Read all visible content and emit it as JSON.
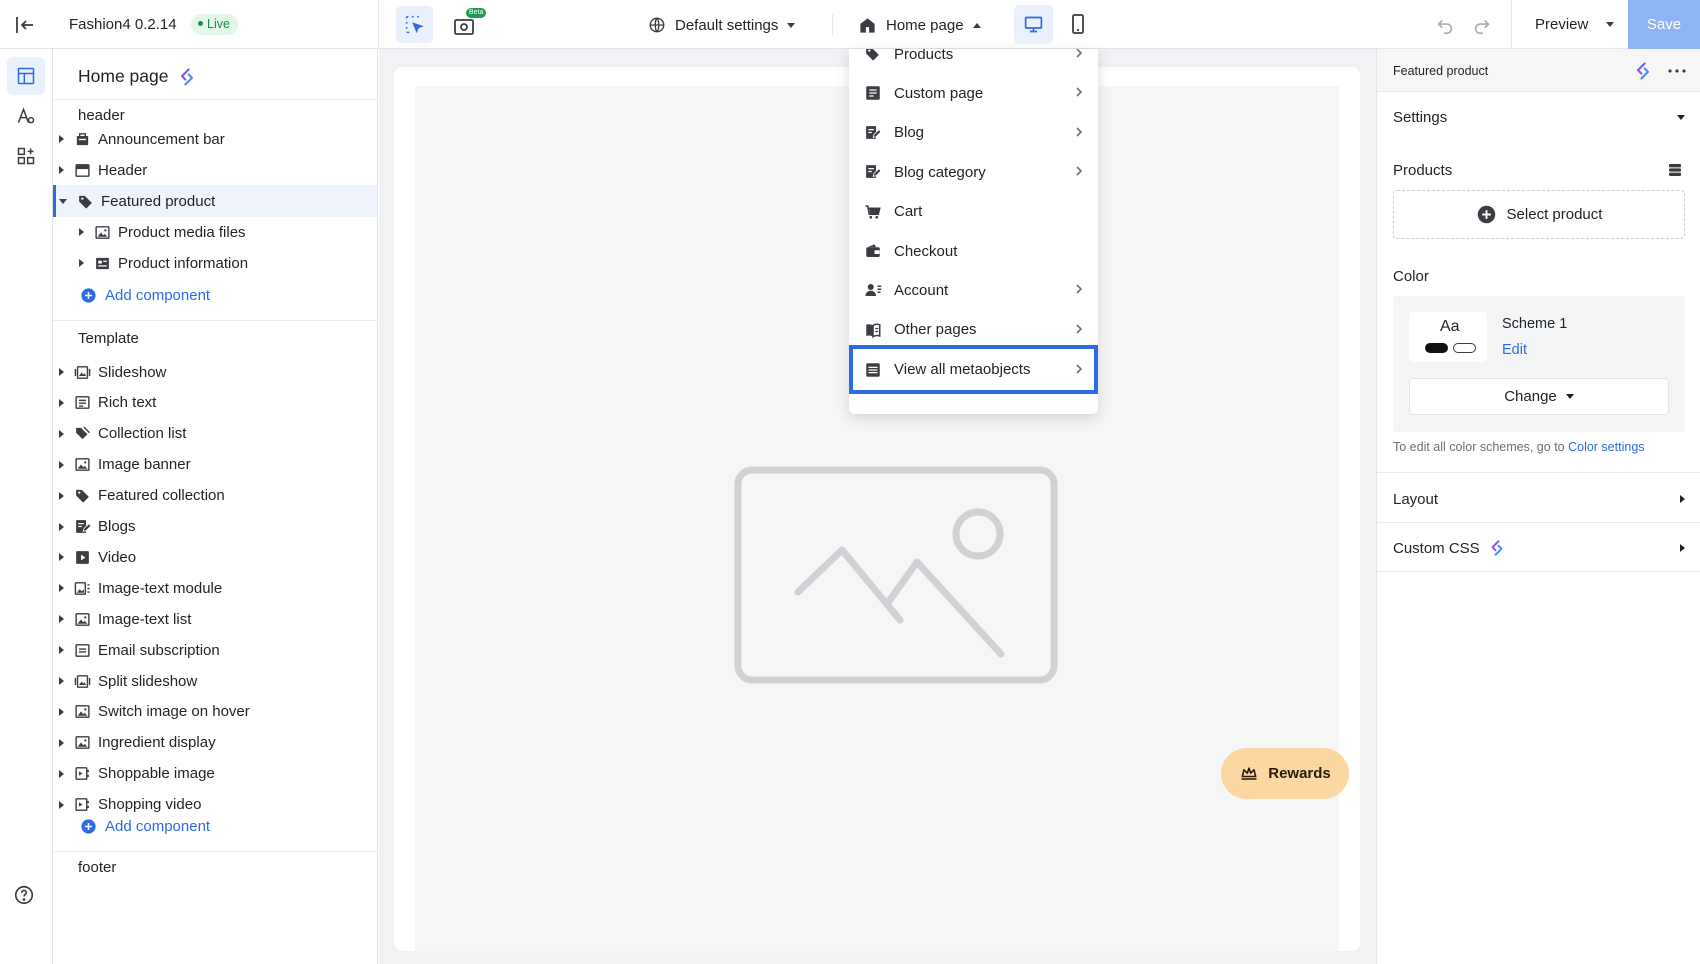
{
  "topbar": {
    "app_name": "Fashion4 0.2.14",
    "live_label": "Live",
    "beta_label": "Beta",
    "theme_settings_label": "Default settings",
    "page_selector_label": "Home page",
    "preview_label": "Preview",
    "save_label": "Save"
  },
  "sidebar": {
    "title": "Home page",
    "groups": {
      "header": "header",
      "template": "Template",
      "footer": "footer"
    },
    "header_items": [
      {
        "label": "Announcement bar",
        "icon": "announcement-icon"
      },
      {
        "label": "Header",
        "icon": "header-icon"
      },
      {
        "label": "Featured product",
        "icon": "tag-icon",
        "selected": true
      }
    ],
    "featured_children": [
      {
        "label": "Product media files",
        "icon": "image-icon"
      },
      {
        "label": "Product information",
        "icon": "info-block-icon"
      }
    ],
    "template_items": [
      {
        "label": "Slideshow",
        "icon": "slideshow-icon"
      },
      {
        "label": "Rich text",
        "icon": "rich-text-icon"
      },
      {
        "label": "Collection list",
        "icon": "collection-icon"
      },
      {
        "label": "Image banner",
        "icon": "image-icon"
      },
      {
        "label": "Featured collection",
        "icon": "tag-icon"
      },
      {
        "label": "Blogs",
        "icon": "blog-icon"
      },
      {
        "label": "Video",
        "icon": "video-icon"
      },
      {
        "label": "Image-text module",
        "icon": "image-text-icon"
      },
      {
        "label": "Image-text list",
        "icon": "image-icon"
      },
      {
        "label": "Email subscription",
        "icon": "email-icon"
      },
      {
        "label": "Split slideshow",
        "icon": "slideshow-icon"
      },
      {
        "label": "Switch image on hover",
        "icon": "image-icon"
      },
      {
        "label": "Ingredient display",
        "icon": "image-icon"
      },
      {
        "label": "Shoppable image",
        "icon": "shoppable-icon"
      },
      {
        "label": "Shopping video",
        "icon": "shoppable-icon"
      }
    ],
    "add_component_label": "Add component"
  },
  "dropdown": {
    "items": [
      {
        "label": "Products",
        "icon": "tag-icon",
        "has_submenu": true
      },
      {
        "label": "Custom page",
        "icon": "page-icon",
        "has_submenu": true
      },
      {
        "label": "Blog",
        "icon": "blog-icon",
        "has_submenu": true
      },
      {
        "label": "Blog category",
        "icon": "blog-icon",
        "has_submenu": true
      },
      {
        "label": "Cart",
        "icon": "cart-icon",
        "has_submenu": false
      },
      {
        "label": "Checkout",
        "icon": "wallet-icon",
        "has_submenu": false
      },
      {
        "label": "Account",
        "icon": "account-icon",
        "has_submenu": true
      },
      {
        "label": "Other pages",
        "icon": "book-icon",
        "has_submenu": true
      },
      {
        "label": "View all metaobjects",
        "icon": "database-icon",
        "has_submenu": true,
        "highlighted": true
      }
    ]
  },
  "canvas": {
    "rewards_label": "Rewards"
  },
  "right_panel": {
    "title": "Featured product",
    "settings_label": "Settings",
    "products_label": "Products",
    "select_product_label": "Select product",
    "color_label": "Color",
    "swatch_sample": "Aa",
    "scheme_name": "Scheme 1",
    "scheme_edit": "Edit",
    "change_label": "Change",
    "hint_text": "To edit all color schemes, go to ",
    "hint_link": "Color settings",
    "layout_label": "Layout",
    "custom_css_label": "Custom CSS"
  },
  "colors": {
    "accent": "#2d6be3",
    "save_disabled": "#8fb4f4",
    "live_badge_bg": "#e3f7e9",
    "rewards_bg": "#fbd8a2",
    "selection_outline": "#2d6be3"
  }
}
